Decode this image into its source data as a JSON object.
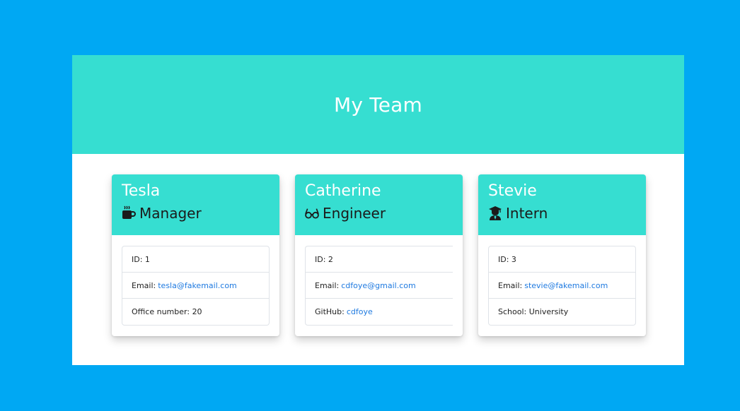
{
  "page": {
    "title": "My Team"
  },
  "colors": {
    "outer_background": "#00a8f3",
    "header_background": "#36ded1",
    "link": "#1f7ae0"
  },
  "team": [
    {
      "name": "Tesla",
      "role": "Manager",
      "role_icon": "coffee-mug-icon",
      "id_label": "ID:",
      "id_value": "1",
      "email_label": "Email:",
      "email_value": "tesla@fakemail.com",
      "extra_label": "Office number:",
      "extra_value": "20"
    },
    {
      "name": "Catherine",
      "role": "Engineer",
      "role_icon": "glasses-icon",
      "id_label": "ID:",
      "id_value": "2",
      "email_label": "Email:",
      "email_value": "cdfoye@gmail.com",
      "extra_label": "GitHub:",
      "extra_value": "cdfoye"
    },
    {
      "name": "Stevie",
      "role": "Intern",
      "role_icon": "graduate-icon",
      "id_label": "ID:",
      "id_value": "3",
      "email_label": "Email:",
      "email_value": "stevie@fakemail.com",
      "extra_label": "School:",
      "extra_value": "University"
    }
  ]
}
